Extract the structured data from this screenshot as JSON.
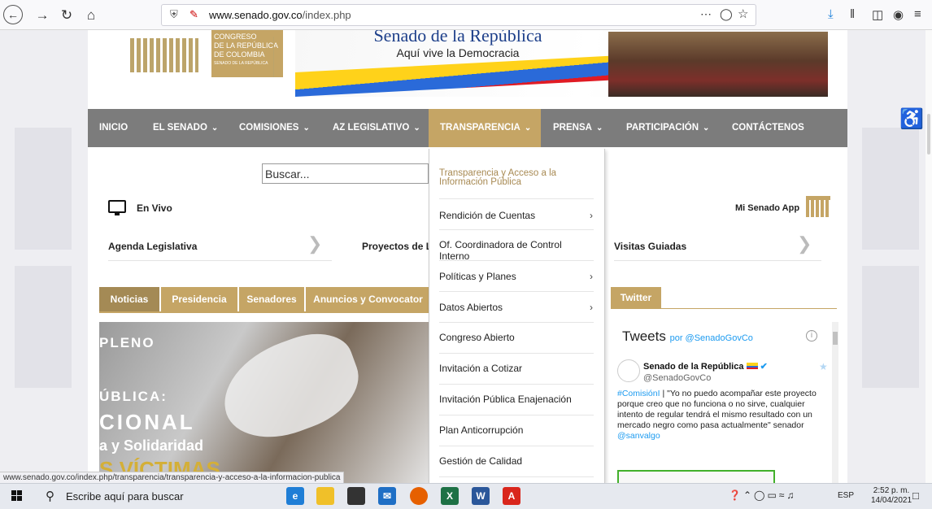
{
  "browser": {
    "url_host": "www.senado.gov.co",
    "url_path": "/index.php",
    "icons": [
      "back-icon",
      "forward-icon",
      "reload-icon",
      "home-icon",
      "shield-icon",
      "site-icon",
      "more-icon",
      "pocket-icon",
      "bookmark-star-icon",
      "download-icon",
      "library-icon",
      "sidebar-icon",
      "account-icon",
      "menu-icon"
    ]
  },
  "header": {
    "logo_line1": "CONGRESO",
    "logo_line2": "DE LA REPÚBLICA",
    "logo_line3": "DE COLOMBIA",
    "logo_line4": "SENADO DE LA REPÚBLICA",
    "banner_title": "Senado de la República",
    "banner_subtitle": "Aquí vive la Democracia"
  },
  "menu": {
    "items": [
      {
        "label": "INICIO",
        "dropdown": false,
        "active": false
      },
      {
        "label": "EL SENADO",
        "dropdown": true,
        "active": false
      },
      {
        "label": "COMISIONES",
        "dropdown": true,
        "active": false
      },
      {
        "label": "AZ LEGISLATIVO",
        "dropdown": true,
        "active": false
      },
      {
        "label": "TRANSPARENCIA",
        "dropdown": true,
        "active": true
      },
      {
        "label": "PRENSA",
        "dropdown": true,
        "active": false
      },
      {
        "label": "PARTICIPACIÓN",
        "dropdown": true,
        "active": false
      },
      {
        "label": "CONTÁCTENOS",
        "dropdown": false,
        "active": false
      }
    ]
  },
  "search": {
    "placeholder": "Buscar..."
  },
  "links": {
    "en_vivo": "En Vivo",
    "mi_senado": "Mi Senado App",
    "agenda": "Agenda Legislativa",
    "proyectos": "Proyectos de L",
    "visitas": "Visitas Guiadas"
  },
  "tabs": [
    {
      "label": "Noticias",
      "active": true
    },
    {
      "label": "Presidencia",
      "active": false
    },
    {
      "label": "Senadores",
      "active": false
    },
    {
      "label": "Anuncios y Convocator",
      "active": false
    }
  ],
  "twitter_tab": "Twitter",
  "hero": {
    "line1": "PLENO",
    "line2": "ÚBLICA:",
    "line3": "CIONAL",
    "line4": "a y Solidaridad",
    "line5": "S VÍCTIMAS"
  },
  "dropdown": {
    "items": [
      {
        "label": "Transparencia y Acceso a la Información Pública",
        "arrow": false
      },
      {
        "label": "Rendición de Cuentas",
        "arrow": true
      },
      {
        "label": "Of. Coordinadora de Control Interno",
        "arrow": false
      },
      {
        "label": "Políticas y Planes",
        "arrow": true
      },
      {
        "label": "Datos Abiertos",
        "arrow": true
      },
      {
        "label": "Congreso Abierto",
        "arrow": false
      },
      {
        "label": "Invitación a Cotizar",
        "arrow": false
      },
      {
        "label": "Invitación Pública Enajenación",
        "arrow": false
      },
      {
        "label": "Plan Anticorrupción",
        "arrow": false
      },
      {
        "label": "Gestión de Calidad",
        "arrow": false
      }
    ]
  },
  "twitter": {
    "title": "Tweets",
    "by": "por @SenadoGovCo",
    "name": "Senado de la República",
    "handle": "@SenadoGovCo",
    "tag": "#ComisiónI",
    "text": " | \"Yo no puedo acompañar este proyecto porque creo que no funciona o no sirve, cualquier intento de regular tendrá el mismo resultado con un mercado negro como pasa actualmente\" senador ",
    "mention": "@sanvalgo"
  },
  "status_url": "www.senado.gov.co/index.php/transparencia/transparencia-y-acceso-a-la-informacion-publica",
  "taskbar": {
    "search_placeholder": "Escribe aquí para buscar",
    "time": "2:52 p. m.",
    "date": "14/04/2021",
    "lang": "ESP",
    "apps": [
      "edge-icon",
      "file-explorer-icon",
      "store-icon",
      "mail-icon",
      "firefox-icon",
      "excel-icon",
      "word-icon",
      "acrobat-icon"
    ]
  },
  "colors": {
    "gold": "#c5a565",
    "menu_gray": "#7c7c7c",
    "twitter_blue": "#1d9bf0"
  }
}
